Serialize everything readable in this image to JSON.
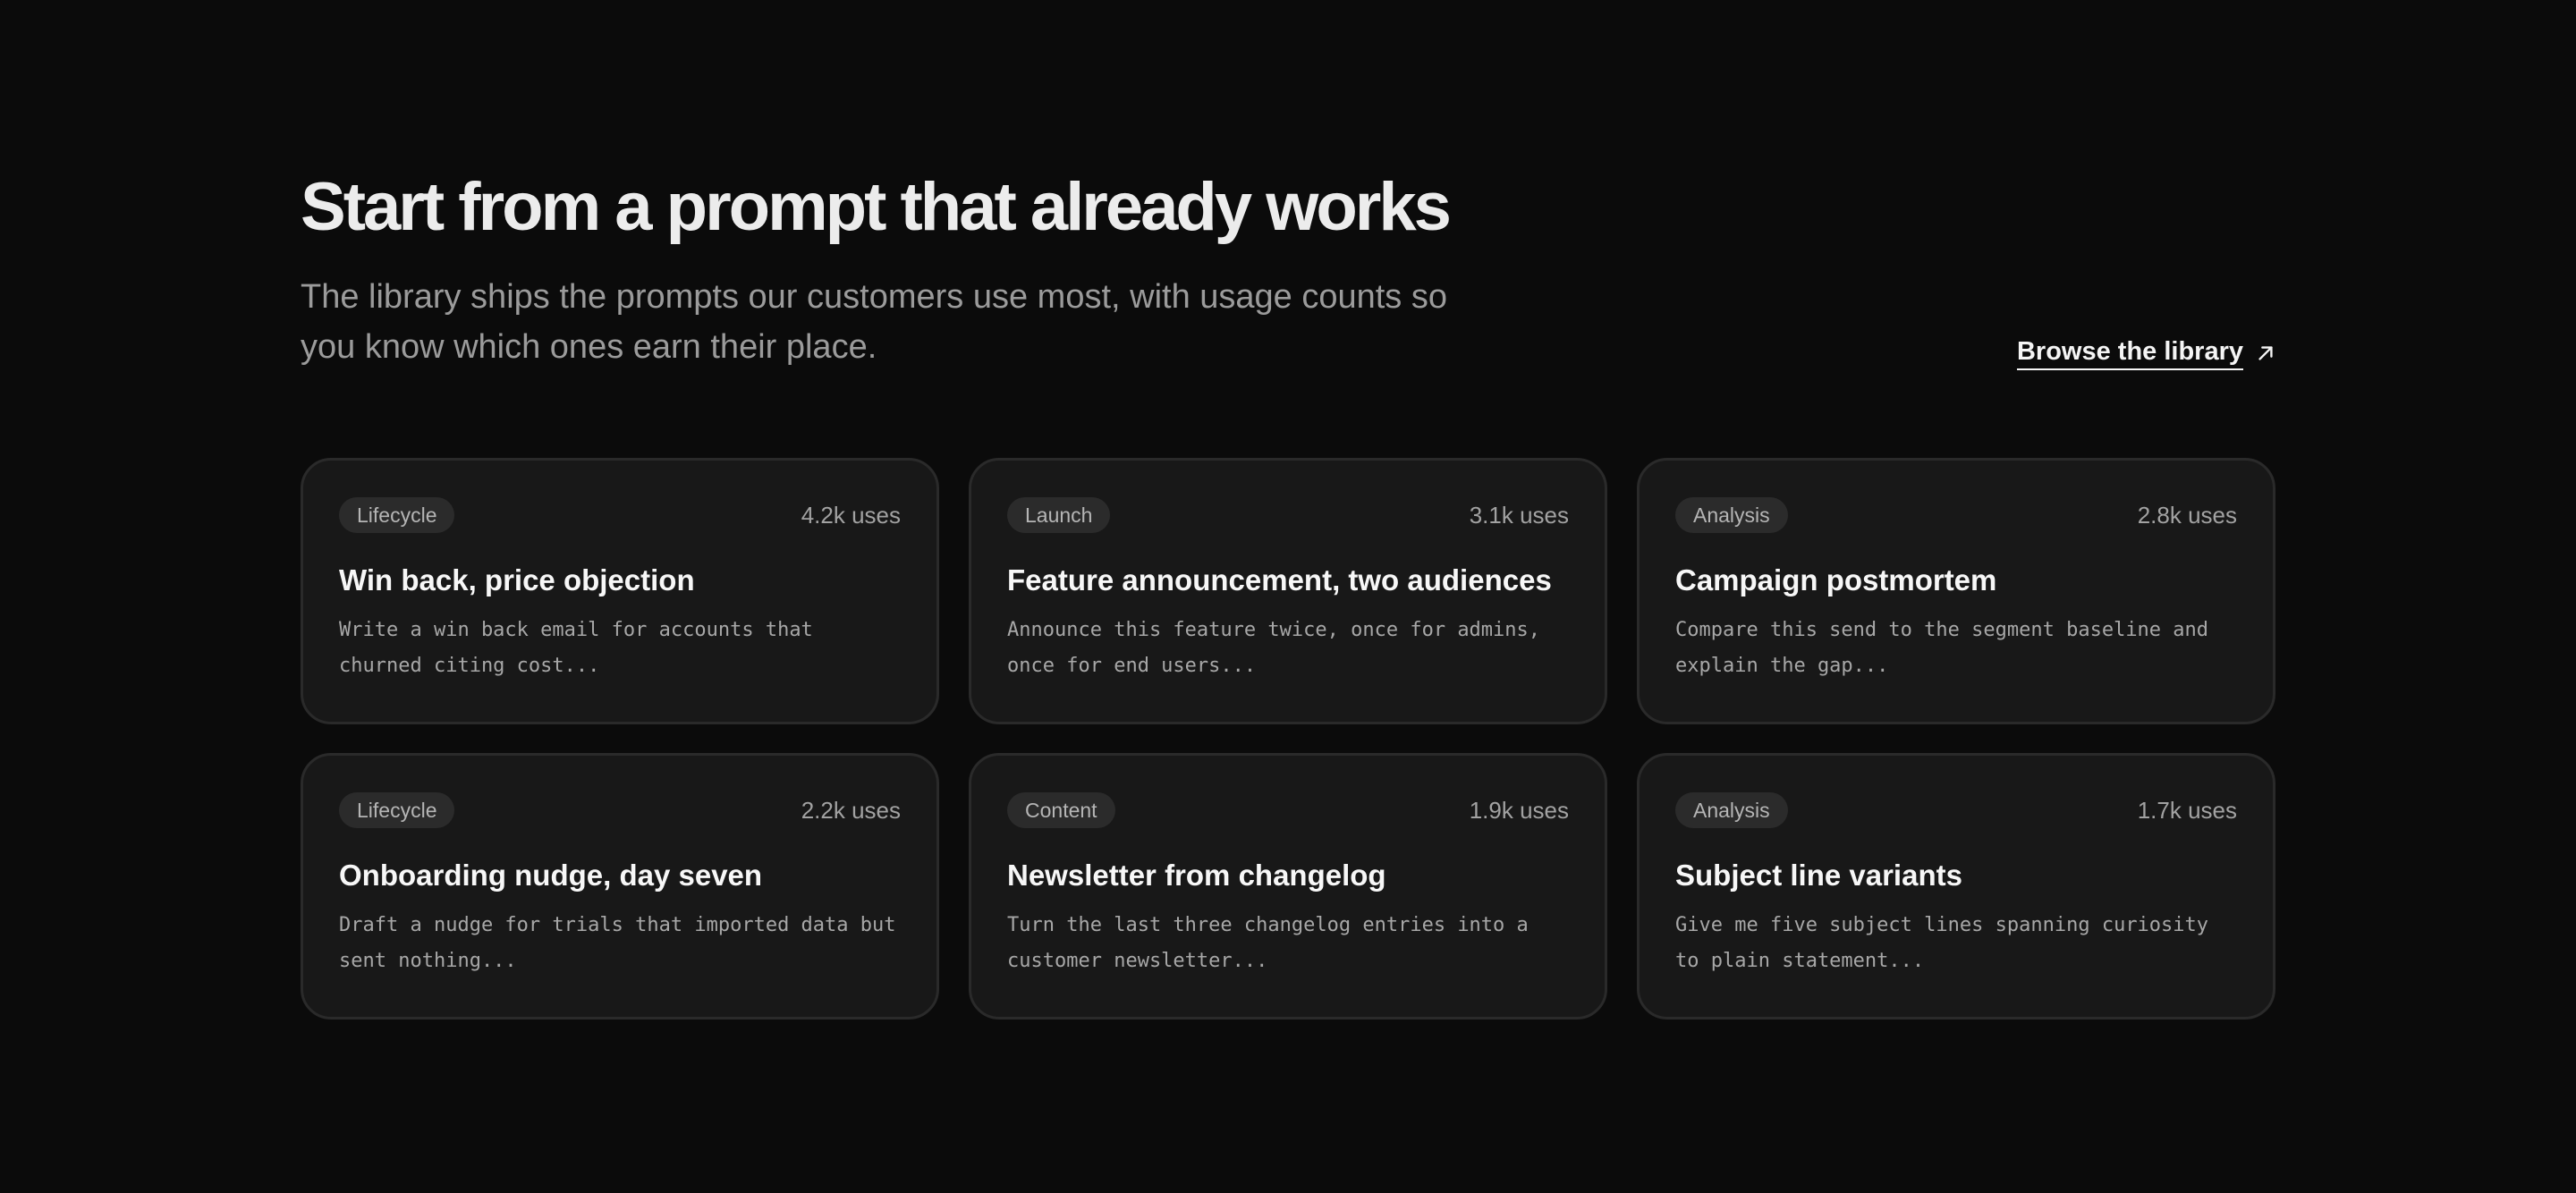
{
  "header": {
    "title": "Start from a prompt that already works",
    "subtitle": "The library ships the prompts our customers use most, with usage counts so you know which ones earn their place.",
    "browse_label": "Browse the library",
    "browse_icon": "arrow-up-right-icon"
  },
  "cards": [
    {
      "tag": "Lifecycle",
      "uses": "4.2k uses",
      "title": "Win back, price objection",
      "desc": "Write a win back email for accounts that churned citing cost..."
    },
    {
      "tag": "Launch",
      "uses": "3.1k uses",
      "title": "Feature announcement, two audiences",
      "desc": "Announce this feature twice, once for admins, once for end users..."
    },
    {
      "tag": "Analysis",
      "uses": "2.8k uses",
      "title": "Campaign postmortem",
      "desc": "Compare this send to the segment baseline and explain the gap..."
    },
    {
      "tag": "Lifecycle",
      "uses": "2.2k uses",
      "title": "Onboarding nudge, day seven",
      "desc": "Draft a nudge for trials that imported data but sent nothing..."
    },
    {
      "tag": "Content",
      "uses": "1.9k uses",
      "title": "Newsletter from changelog",
      "desc": "Turn the last three changelog entries into a customer newsletter..."
    },
    {
      "tag": "Analysis",
      "uses": "1.7k uses",
      "title": "Subject line variants",
      "desc": "Give me five subject lines spanning curiosity to plain statement..."
    }
  ],
  "colors": {
    "background": "#0b0b0b",
    "card": "#181818",
    "card_border": "#2a2a2a",
    "tag": "#2b2b2b"
  }
}
